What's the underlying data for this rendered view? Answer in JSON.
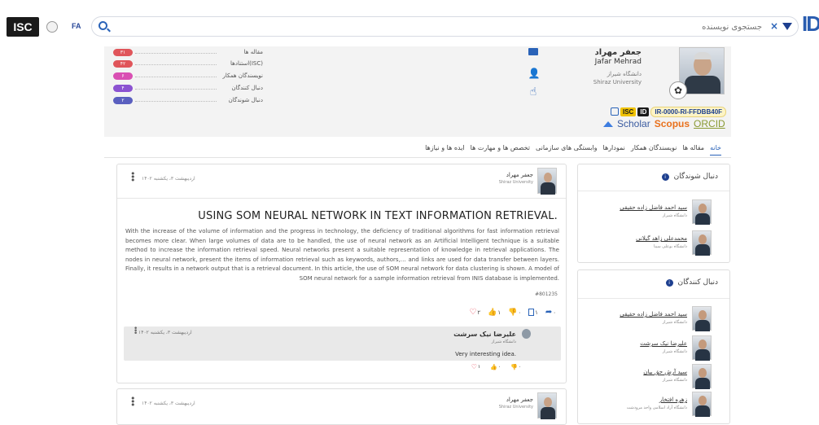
{
  "topbar": {
    "logo_text": "ISC",
    "lang": "FA",
    "search_placeholder": "جستجوی نویسنده",
    "clear_label": "×",
    "id_logo_text": "ID"
  },
  "profile": {
    "name_fa": "جعفر مهراد",
    "name_en": "Jafar Mehrad",
    "university_fa": "دانشگاه شیراز",
    "university_en": "Shiraz University",
    "isc_badge": "ISC",
    "id_badge": "ID",
    "isc_id": "IR-0000-RI-FFDBB40F",
    "links": {
      "scholar": "Scholar",
      "scopus": "Scopus",
      "orcid": "ORCID"
    },
    "stats": [
      {
        "label": "مقاله ها",
        "value": "۳۱",
        "color": "#e0555a"
      },
      {
        "label": "استنادها(ISC)",
        "value": "۴۲",
        "color": "#e0555a"
      },
      {
        "label": "نویسندگان همکار",
        "value": "۶",
        "color": "#d94fb3"
      },
      {
        "label": "دنبال کنندگان",
        "value": "۴",
        "color": "#8b52d1"
      },
      {
        "label": "دنبال شوندگان",
        "value": "۲",
        "color": "#5a5fbf"
      }
    ]
  },
  "tabs": [
    {
      "label": "خانه",
      "active": true
    },
    {
      "label": "مقاله ها"
    },
    {
      "label": "نویسندگان همکار"
    },
    {
      "label": "نمودارها"
    },
    {
      "label": "وابستگی های سازمانی"
    },
    {
      "label": "تخصص ها و مهارت ها"
    },
    {
      "label": "ایده ها و نیازها"
    }
  ],
  "followings": {
    "title": "دنبال شوندگان",
    "people": [
      {
        "name": "سید احمد فاضل زاده حقیقی",
        "uni": "دانشگاه شیراز"
      },
      {
        "name": "محمدعلی زاهد گیلانی",
        "uni": "دانشگاه بوعلی سینا"
      }
    ]
  },
  "followers": {
    "title": "دنبال کنندگان",
    "people": [
      {
        "name": "سید احمد فاضل زاده حقیقی",
        "uni": "دانشگاه شیراز"
      },
      {
        "name": "علیرضا نیک سرشت",
        "uni": "دانشگاه شیراز"
      },
      {
        "name": "سید آرش حق بیان",
        "uni": "دانشگاه شیراز"
      },
      {
        "name": "زهره افتخار",
        "uni": "دانشگاه آزاد اسلامی واحد مرودشت"
      }
    ]
  },
  "post": {
    "author": "جعفر مهراد",
    "author_uni": "Shiraz University",
    "date": "۱۴۰۲ اردیبهشت ۳، یکشنبه",
    "title": "USING SOM NEURAL NETWORK IN TEXT INFORMATION RETRIEVAL.",
    "body": "With the increase of the volume of information and the progress in technology, the deficiency of traditional algorithms for fast information retrieval becomes more clear. When large volumes of data are to be handled, the use of neural network as an Artificial Intelligent technique is a suitable method to increase the information retrieval speed. Neural networks present a suitable representation of knowledge in retrieval applications. The nodes in neural network, present the items of information retrieval such as keywords, authors,… and links are used for data transfer between layers. Finally, it results in a network output that is a retrieval document. In this article, the use of SOM neural network for data clustering is shown. A model of SOM neural network for a sample information retrieval from INIS database is implemented.",
    "code": "#801235",
    "reactions": {
      "heart": "۲",
      "like": "۱",
      "dislike": "۰",
      "bookmark": "۱",
      "share": "۰"
    },
    "comment": {
      "author": "علیرضا نیک سرشت",
      "uni": "دانشگاه شیراز",
      "text": "Very interesting idea.",
      "date": "۱۴۰۲ اردیبهشت ۳، یکشنبه",
      "heart": "۱",
      "like": "۰",
      "dislike": "۰"
    }
  },
  "post2": {
    "author": "جعفر مهراد",
    "author_uni": "Shiraz University",
    "date": "۱۴۰۲ اردیبهشت ۳، یکشنبه"
  }
}
